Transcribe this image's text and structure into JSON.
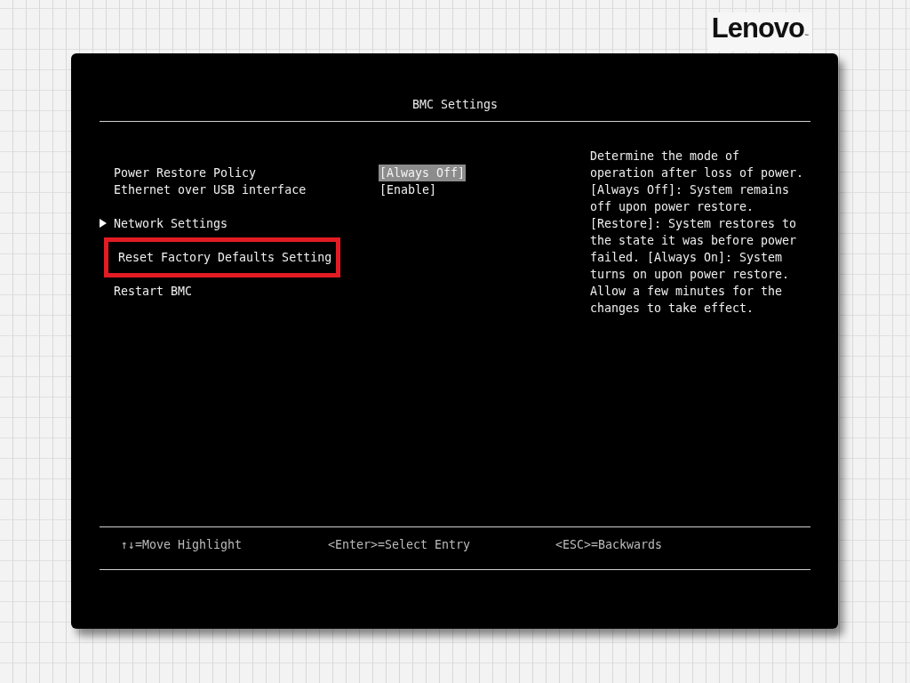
{
  "logo": {
    "text": "Lenovo",
    "mark": "™"
  },
  "screen": {
    "title": "BMC Settings",
    "groups": [
      [
        {
          "kind": "setting",
          "label": "Power Restore Policy",
          "value": "[Always Off]",
          "value_focused": true,
          "selected": false
        },
        {
          "kind": "setting",
          "label": "Ethernet over USB interface",
          "value": "[Enable]",
          "value_focused": false,
          "selected": false
        }
      ],
      [
        {
          "kind": "submenu",
          "label": "Network Settings",
          "selected": false
        }
      ],
      [
        {
          "kind": "action",
          "label": "Reset Factory Defaults Setting",
          "selected": true
        }
      ],
      [
        {
          "kind": "action",
          "label": "Restart BMC",
          "selected": false
        }
      ]
    ],
    "help": "Determine the mode of operation after loss of power. [Always Off]: System remains off upon power restore. [Restore]: System restores to the state it was before power failed. [Always On]: System turns on upon power restore. Allow a few minutes for the changes to take effect.",
    "footer": [
      "↑↓=Move Highlight",
      "<Enter>=Select Entry",
      "<ESC>=Backwards"
    ]
  }
}
